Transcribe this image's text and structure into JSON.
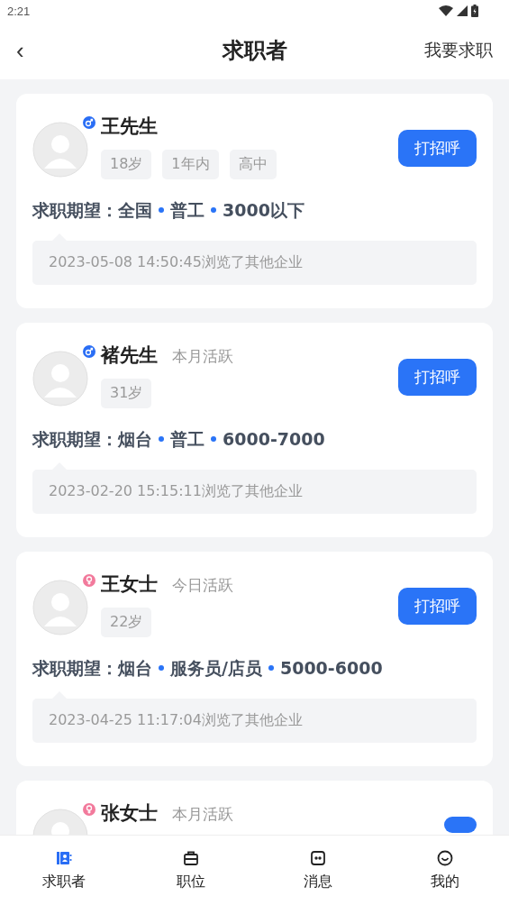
{
  "status_bar": {
    "time": "2:21"
  },
  "header": {
    "back": "‹",
    "title": "求职者",
    "action": "我要求职"
  },
  "candidates": [
    {
      "name": "王先生",
      "kind": "male",
      "tags": [
        "18岁",
        "1年内",
        "高中"
      ],
      "expectation": {
        "label": "求职期望：",
        "items": [
          "全国",
          "普工",
          "3000以下"
        ]
      },
      "log": "2023-05-08 14:50:45浏览了其他企业",
      "button": "打招呼"
    },
    {
      "name": "褚先生",
      "kind": "male",
      "activity": "本月活跃",
      "tags": [
        "31岁"
      ],
      "expectation": {
        "label": "求职期望：",
        "items": [
          "烟台",
          "普工",
          "6000-7000"
        ]
      },
      "log": "2023-02-20 15:15:11浏览了其他企业",
      "button": "打招呼"
    },
    {
      "name": "王女士",
      "kind": "female",
      "activity": "今日活跃",
      "tags": [
        "22岁"
      ],
      "expectation": {
        "label": "求职期望：",
        "items": [
          "烟台",
          "服务员/店员",
          "5000-6000"
        ]
      },
      "log": "2023-04-25 11:17:04浏览了其他企业",
      "button": "打招呼"
    },
    {
      "name": "张女士",
      "kind": "female",
      "activity": "本月活跃"
    }
  ],
  "tab_bar": [
    {
      "label": "求职者",
      "selected": true
    },
    {
      "label": "职位",
      "selected": false
    },
    {
      "label": "消息",
      "selected": false
    },
    {
      "label": "我的",
      "selected": false
    }
  ]
}
